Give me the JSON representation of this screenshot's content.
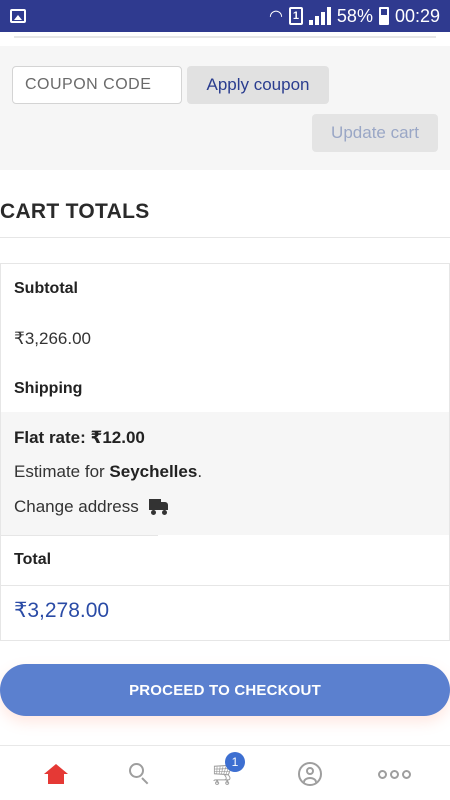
{
  "status_bar": {
    "battery": "58%",
    "time": "00:29",
    "sim": "1"
  },
  "coupon": {
    "placeholder": "COUPON CODE",
    "apply_label": "Apply coupon",
    "update_label": "Update cart"
  },
  "cart_totals": {
    "title": "CART TOTALS",
    "subtotal_label": "Subtotal",
    "subtotal_value": "₹3,266.00",
    "shipping_label": "Shipping",
    "flat_rate": "Flat rate: ₹12.00",
    "estimate_prefix": "Estimate for ",
    "estimate_country": "Seychelles",
    "estimate_suffix": ".",
    "change_address": "Change address",
    "total_label": "Total",
    "total_value": "₹3,278.00"
  },
  "checkout": {
    "label": "PROCEED TO CHECKOUT"
  },
  "bottom_nav": {
    "cart_count": "1",
    "items": [
      "home-icon",
      "search-icon",
      "cart-icon",
      "user-icon",
      "more-icon"
    ]
  },
  "colors": {
    "status_bar": "#2f3a8f",
    "accent": "#5b80cf",
    "total_value": "#2a4ba6",
    "home_active": "#e53935"
  }
}
